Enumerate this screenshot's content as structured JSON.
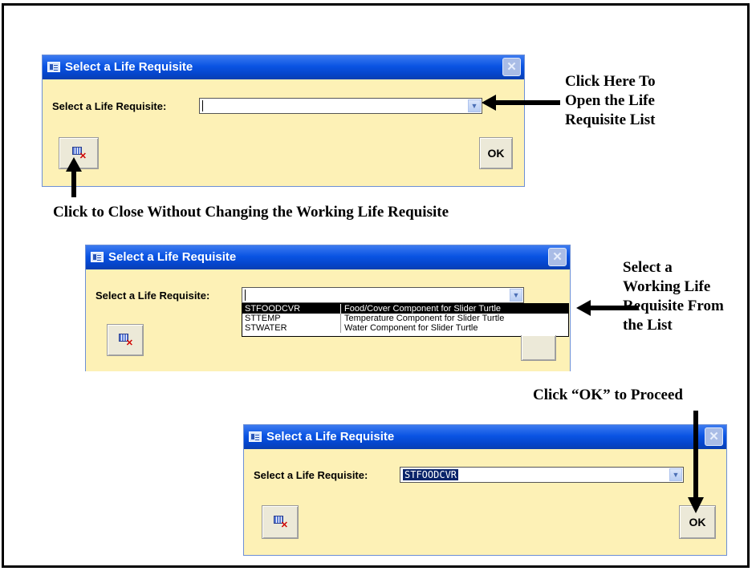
{
  "dialog1": {
    "title": "Select a Life Requisite",
    "close_glyph": "✕",
    "field_label": "Select a Life Requisite:",
    "combo_value": "",
    "dropdown_glyph": "▼",
    "close_form_icon": "close-form-icon",
    "ok_label": "OK"
  },
  "annotation1": [
    "Click Here To",
    "Open the Life",
    "Requisite List"
  ],
  "annotation2": "Click to Close Without Changing the Working Life Requisite",
  "dialog2": {
    "title": "Select a Life Requisite",
    "close_glyph": "✕",
    "field_label": "Select a Life Requisite:",
    "combo_value": "",
    "dropdown_glyph": "▼",
    "list": [
      {
        "code": "STFOODCVR",
        "desc": "Food/Cover Component for Slider Turtle",
        "selected": true
      },
      {
        "code": "STTEMP",
        "desc": "Temperature Component for Slider Turtle",
        "selected": false
      },
      {
        "code": "STWATER",
        "desc": "Water Component for Slider Turtle",
        "selected": false
      }
    ]
  },
  "annotation3": [
    "Select a",
    "Working Life",
    "Requisite From",
    "the List"
  ],
  "annotation4": "Click “OK” to Proceed",
  "dialog3": {
    "title": "Select a Life Requisite",
    "close_glyph": "✕",
    "field_label": "Select a Life Requisite:",
    "combo_value": "STFOODCVR",
    "dropdown_glyph": "▼",
    "ok_label": "OK"
  },
  "colors": {
    "titlebar": "#0a54e3",
    "dialog_body": "#fdf1b6",
    "selection": "#0a246a"
  }
}
